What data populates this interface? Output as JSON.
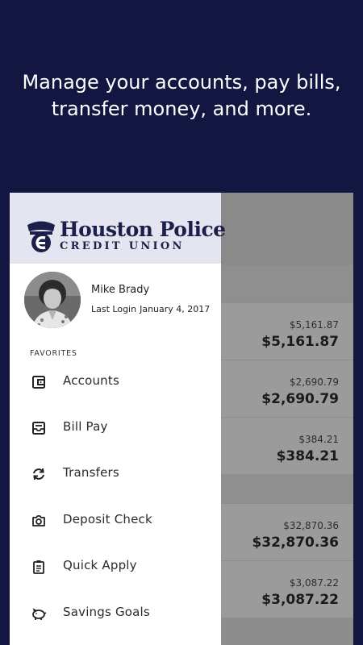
{
  "promo": {
    "headline_line1": "Manage your accounts, pay bills,",
    "headline_line2": "transfer money, and more."
  },
  "colors": {
    "background": "#131640",
    "drawer_header": "#e4e5f0",
    "brand_navy": "#1c1f4a"
  },
  "logo": {
    "name": "Houston Police",
    "subtitle": "CREDIT UNION"
  },
  "user": {
    "name": "Mike Brady",
    "last_login_label": "Last Login",
    "last_login_date": "January 4, 2017"
  },
  "favorites_label": "FAVORITES",
  "menu": [
    {
      "label": "Accounts",
      "icon": "wallet-icon"
    },
    {
      "label": "Bill Pay",
      "icon": "bill-icon"
    },
    {
      "label": "Transfers",
      "icon": "transfer-arrows-icon"
    },
    {
      "label": "Deposit Check",
      "icon": "camera-icon"
    },
    {
      "label": "Quick Apply",
      "icon": "clipboard-icon"
    },
    {
      "label": "Savings Goals",
      "icon": "piggy-bank-icon"
    }
  ],
  "accounts": [
    {
      "available": "$5,161.87",
      "current": "$5,161.87"
    },
    {
      "available": "$2,690.79",
      "current": "$2,690.79"
    },
    {
      "available": "$384.21",
      "current": "$384.21"
    },
    {
      "available": "$32,870.36",
      "current": "$32,870.36"
    },
    {
      "available": "$3,087.22",
      "current": "$3,087.22"
    }
  ]
}
